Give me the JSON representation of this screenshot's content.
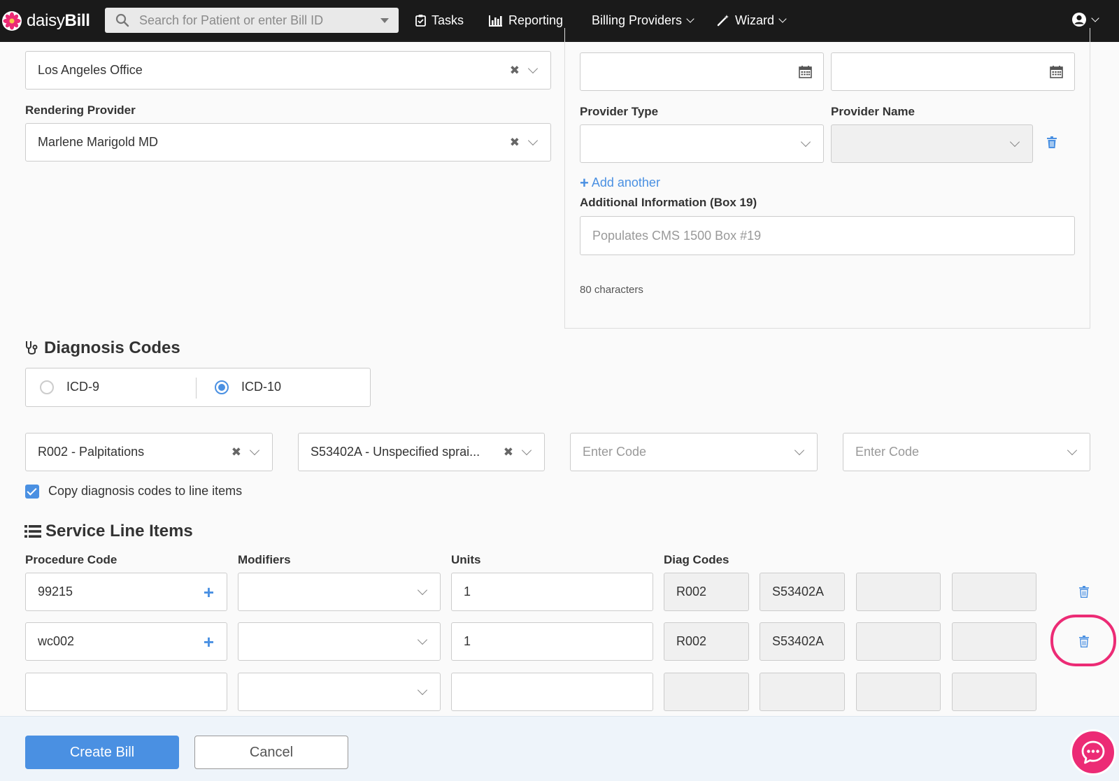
{
  "navbar": {
    "logo_light": "daisy",
    "logo_bold": "Bill",
    "search_placeholder": "Search for Patient or enter Bill ID",
    "tasks": "Tasks",
    "reporting": "Reporting",
    "billing_providers": "Billing Providers",
    "wizard": "Wizard",
    "icons": {
      "tasks": "clipboard-check-icon",
      "reporting": "bar-chart-icon",
      "wizard": "magic-wand-icon",
      "user": "user-circle-icon"
    }
  },
  "place_of_service": {
    "value": "Los Angeles Office"
  },
  "rendering_provider": {
    "label": "Rendering Provider",
    "value": "Marlene Marigold MD"
  },
  "provider": {
    "type_label": "Provider Type",
    "name_label": "Provider Name"
  },
  "add_another": "Add another",
  "additional_info": {
    "label": "Additional Information (Box 19)",
    "placeholder": "Populates CMS 1500 Box #19",
    "char_count": "80 characters"
  },
  "diagnosis": {
    "title": "Diagnosis Codes",
    "icd9": "ICD-9",
    "icd10": "ICD-10",
    "selected": "ICD-10",
    "codes": [
      "R002 - Palpitations",
      "S53402A - Unspecified sprai..."
    ],
    "empty_placeholder": "Enter Code",
    "copy_label": "Copy diagnosis codes to line items",
    "copy_checked": true
  },
  "service_lines": {
    "title": "Service Line Items",
    "headers": {
      "procedure": "Procedure Code",
      "modifiers": "Modifiers",
      "units": "Units",
      "diag": "Diag Codes"
    },
    "rows": [
      {
        "procedure": "99215",
        "units": "1",
        "diag1": "R002",
        "diag2": "S53402A"
      },
      {
        "procedure": "wc002",
        "units": "1",
        "diag1": "R002",
        "diag2": "S53402A"
      },
      {
        "procedure": "",
        "units": "",
        "diag1": "",
        "diag2": ""
      }
    ]
  },
  "footer": {
    "create": "Create Bill",
    "cancel": "Cancel"
  },
  "colors": {
    "accent": "#4a90e2",
    "highlight": "#ec2b75",
    "navbar": "#1a1a1a"
  }
}
